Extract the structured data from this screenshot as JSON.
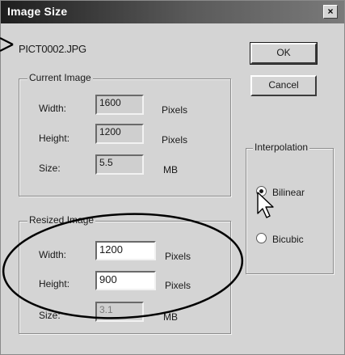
{
  "dialog": {
    "title": "Image Size",
    "close_label": "×",
    "filename": "PICT0002.JPG"
  },
  "buttons": {
    "ok_label": "OK",
    "cancel_label": "Cancel"
  },
  "current_image": {
    "group_label": "Current Image",
    "width_label": "Width:",
    "width_value": "1600",
    "width_unit": "Pixels",
    "height_label": "Height:",
    "height_value": "1200",
    "height_unit": "Pixels",
    "size_label": "Size:",
    "size_value": "5.5",
    "size_unit": "MB"
  },
  "resized_image": {
    "group_label": "Resized Image",
    "width_label": "Width:",
    "width_value": "1200",
    "width_unit": "Pixels",
    "height_label": "Height:",
    "height_value": "900",
    "height_unit": "Pixels",
    "size_label": "Size:",
    "size_value": "3.1",
    "size_unit": "MB"
  },
  "interpolation": {
    "group_label": "Interpolation",
    "options": [
      "Bilinear",
      "Bicubic"
    ],
    "selected": "Bilinear"
  },
  "icons": {
    "close": "close-icon",
    "cursor": "mouse-pointer-icon",
    "callout_arrow": "arrow-icon"
  }
}
